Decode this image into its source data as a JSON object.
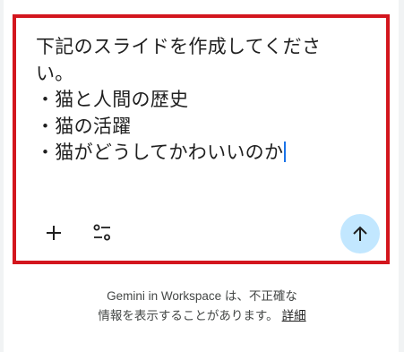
{
  "prompt": {
    "lines": [
      "下記のスライドを作成してくださ",
      "い。",
      "・猫と人間の歴史",
      "・猫の活躍",
      "・猫がどうしてかわいいのか"
    ]
  },
  "toolbar": {
    "add_icon": "plus-icon",
    "tools_icon": "tune-icon",
    "send_icon": "arrow-up-icon"
  },
  "disclaimer": {
    "line1": "Gemini in Workspace は、不正確な",
    "line2": "情報を表示することがあります。",
    "details_link": "詳細"
  },
  "colors": {
    "highlight_border": "#d3161e",
    "send_button_bg": "#c2e7ff",
    "cursor": "#1a73e8",
    "text": "#1f1f1f",
    "muted_text": "#444746"
  }
}
